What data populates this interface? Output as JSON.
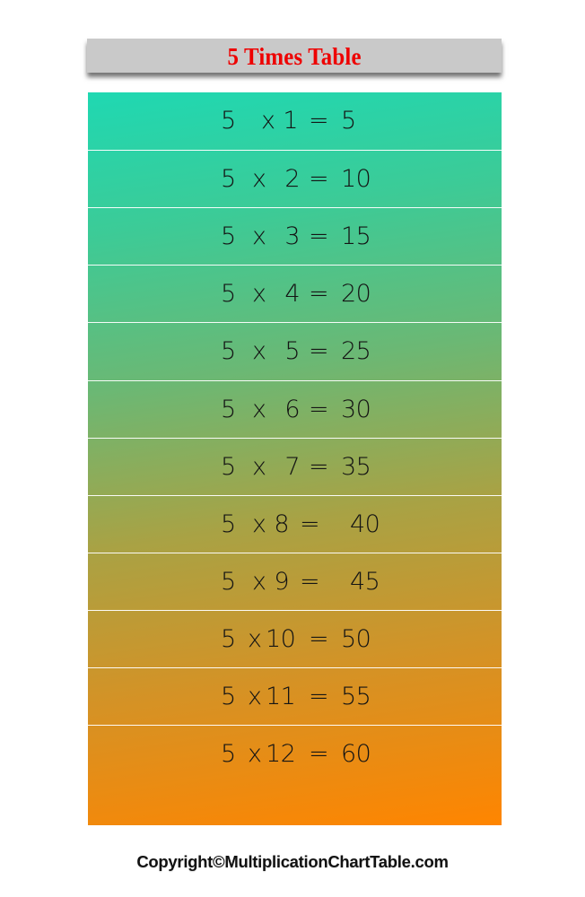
{
  "title": "5 Times Table",
  "colors": {
    "title_text": "#ee0000",
    "title_bg": "#c9c9c9",
    "gradient_start": "#1fd8b2",
    "gradient_end": "#ff8500",
    "row_divider": "#ffffff"
  },
  "rows": [
    {
      "a": "5",
      "op": "x",
      "b": "1",
      "eq": "=",
      "result": "5"
    },
    {
      "a": "5",
      "op": "x",
      "b": "2",
      "eq": "=",
      "result": "10"
    },
    {
      "a": "5",
      "op": "x",
      "b": "3",
      "eq": "=",
      "result": "15"
    },
    {
      "a": "5",
      "op": "x",
      "b": "4",
      "eq": "=",
      "result": "20"
    },
    {
      "a": "5",
      "op": "x",
      "b": "5",
      "eq": "=",
      "result": "25"
    },
    {
      "a": "5",
      "op": "x",
      "b": "6",
      "eq": "=",
      "result": "30"
    },
    {
      "a": "5",
      "op": "x",
      "b": "7",
      "eq": "=",
      "result": "35"
    },
    {
      "a": "5",
      "op": "x",
      "b": "8",
      "eq": "=",
      "result": "40"
    },
    {
      "a": "5",
      "op": "x",
      "b": "9",
      "eq": "=",
      "result": "45"
    },
    {
      "a": "5",
      "op": "x",
      "b": "10",
      "eq": "=",
      "result": "50"
    },
    {
      "a": "5",
      "op": "x",
      "b": "11",
      "eq": "=",
      "result": "55"
    },
    {
      "a": "5",
      "op": "x",
      "b": "12",
      "eq": "=",
      "result": "60"
    }
  ],
  "footer": "Copyright©MultiplicationChartTable.com"
}
